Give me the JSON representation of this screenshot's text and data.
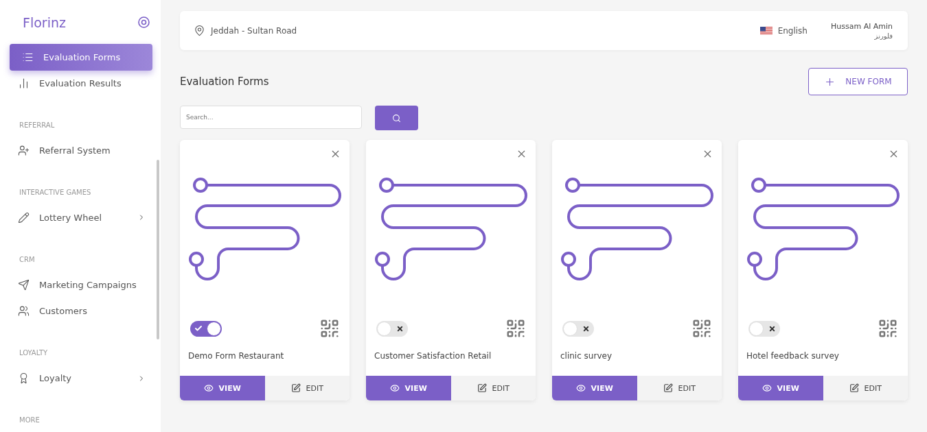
{
  "sidebar": {
    "brand": "Florinz",
    "items": [
      {
        "kind": "item",
        "label": "Evaluation Forms",
        "selected": true,
        "has_submenu": false
      },
      {
        "kind": "item",
        "label": "Evaluation Results",
        "selected": false,
        "has_submenu": false
      },
      {
        "kind": "header",
        "label": "REFERRAL"
      },
      {
        "kind": "item",
        "label": "Referral System",
        "selected": false,
        "has_submenu": false
      },
      {
        "kind": "header",
        "label": "INTERACTIVE GAMES"
      },
      {
        "kind": "item",
        "label": "Lottery Wheel",
        "selected": false,
        "has_submenu": true
      },
      {
        "kind": "header",
        "label": "CRM"
      },
      {
        "kind": "item",
        "label": "Marketing Campaigns",
        "selected": false,
        "has_submenu": false
      },
      {
        "kind": "item",
        "label": "Customers",
        "selected": false,
        "has_submenu": false
      },
      {
        "kind": "header",
        "label": "LOYALTY"
      },
      {
        "kind": "item",
        "label": "Loyalty",
        "selected": false,
        "has_submenu": true
      },
      {
        "kind": "header",
        "label": "MORE"
      }
    ]
  },
  "header": {
    "location": "Jeddah - Sultan Road",
    "language": "English",
    "user_name": "Hussam Al Amin",
    "user_subtitle": "فلورنز"
  },
  "page": {
    "title": "Evaluation Forms",
    "new_button": "NEW FORM",
    "search": {
      "placeholder": "Search..."
    }
  },
  "forms": [
    {
      "name": "Demo Form Restaurant",
      "on": true,
      "view": "VIEW",
      "edit": "EDIT"
    },
    {
      "name": "Customer Satisfaction Retail",
      "on": false,
      "view": "VIEW",
      "edit": "EDIT"
    },
    {
      "name": "clinic survey",
      "on": false,
      "view": "VIEW",
      "edit": "EDIT"
    },
    {
      "name": "Hotel feedback survey",
      "on": false,
      "view": "VIEW",
      "edit": "EDIT"
    }
  ]
}
